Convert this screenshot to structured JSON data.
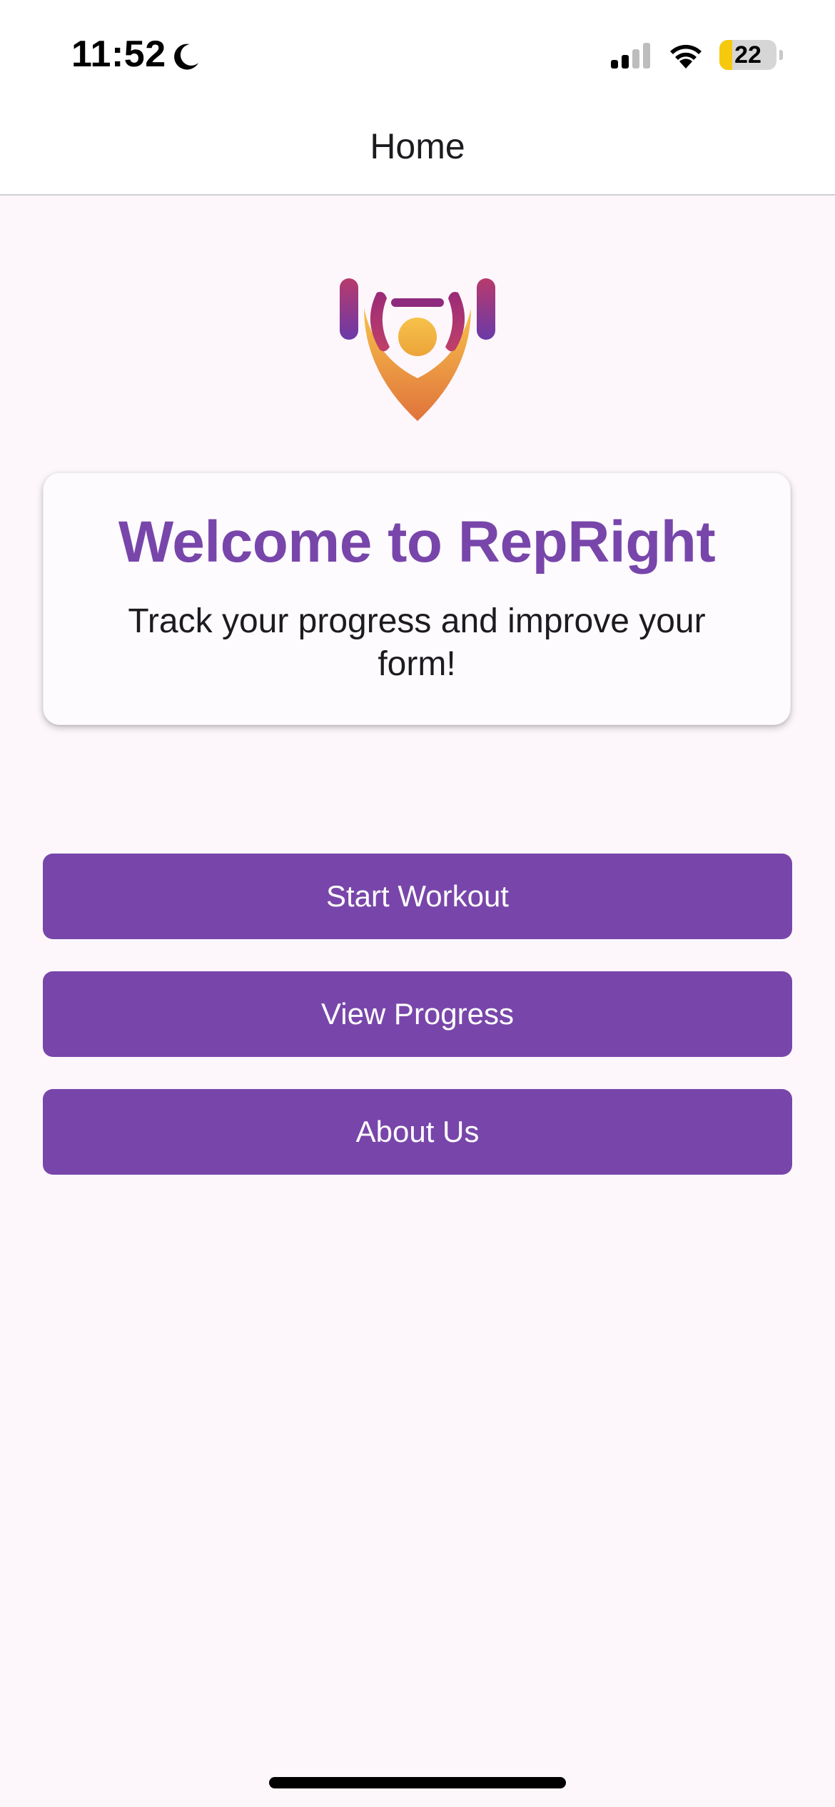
{
  "status_bar": {
    "time": "11:52",
    "battery_percent": "22",
    "battery_level": 0.22,
    "icons": [
      "moon-icon",
      "cellular-signal-icon",
      "wifi-icon",
      "battery-icon"
    ]
  },
  "app_bar": {
    "title": "Home"
  },
  "logo": {
    "icon": "weightlifter-logo-icon",
    "colors": {
      "bar": "#8e2a7e",
      "plates": "#7a3aa8",
      "body_top": "#f4b63a",
      "body_bottom": "#e0733c"
    }
  },
  "welcome_card": {
    "title": "Welcome to RepRight",
    "subtitle": "Track your progress and improve your form!"
  },
  "buttons": {
    "start_workout": "Start Workout",
    "view_progress": "View Progress",
    "about_us": "About Us"
  },
  "theme": {
    "primary": "#7846aa",
    "background": "#fdf7fc",
    "card": "#fefbff"
  }
}
